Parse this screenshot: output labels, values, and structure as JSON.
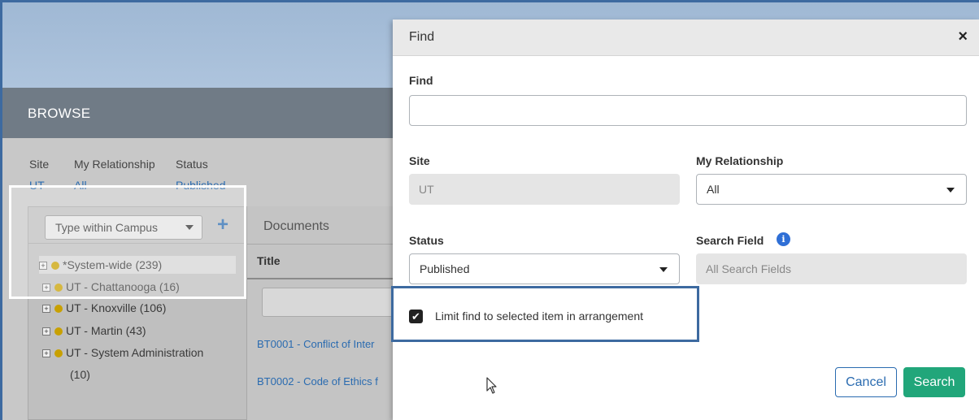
{
  "browse": {
    "title": "BROWSE",
    "filters": [
      {
        "label": "Site",
        "value": "UT"
      },
      {
        "label": "My Relationship",
        "value": "All"
      },
      {
        "label": "Status",
        "value": "Published"
      }
    ]
  },
  "tree": {
    "type_dropdown": "Type within Campus",
    "add_icon": "plus-icon",
    "nodes": [
      {
        "label": "*System-wide (239)"
      },
      {
        "label": "UT - Chattanooga (16)"
      },
      {
        "label": "UT - Knoxville (106)"
      },
      {
        "label": "UT - Martin (43)"
      },
      {
        "label": "UT - System Administration"
      },
      {
        "label": "(10)"
      }
    ]
  },
  "documents": {
    "title": "Documents",
    "column_title": "Title",
    "rows": [
      {
        "label": "BT0001 - Conflict of Inter"
      },
      {
        "label": "BT0002 - Code of Ethics f"
      }
    ]
  },
  "modal": {
    "title": "Find",
    "close_symbol": "×",
    "find_label": "Find",
    "find_value": "",
    "site_label": "Site",
    "site_value": "UT",
    "relationship_label": "My Relationship",
    "relationship_value": "All",
    "status_label": "Status",
    "status_value": "Published",
    "search_field_label": "Search Field",
    "search_field_value": "All Search Fields",
    "limit_checked": true,
    "limit_label": "Limit find to selected item in arrangement",
    "cancel_label": "Cancel",
    "search_label": "Search"
  },
  "colors": {
    "accent_blue": "#2a6bb0",
    "search_green": "#21a67a",
    "highlight_frame": "#3d6aa0",
    "node_dot": "#c8a000"
  }
}
